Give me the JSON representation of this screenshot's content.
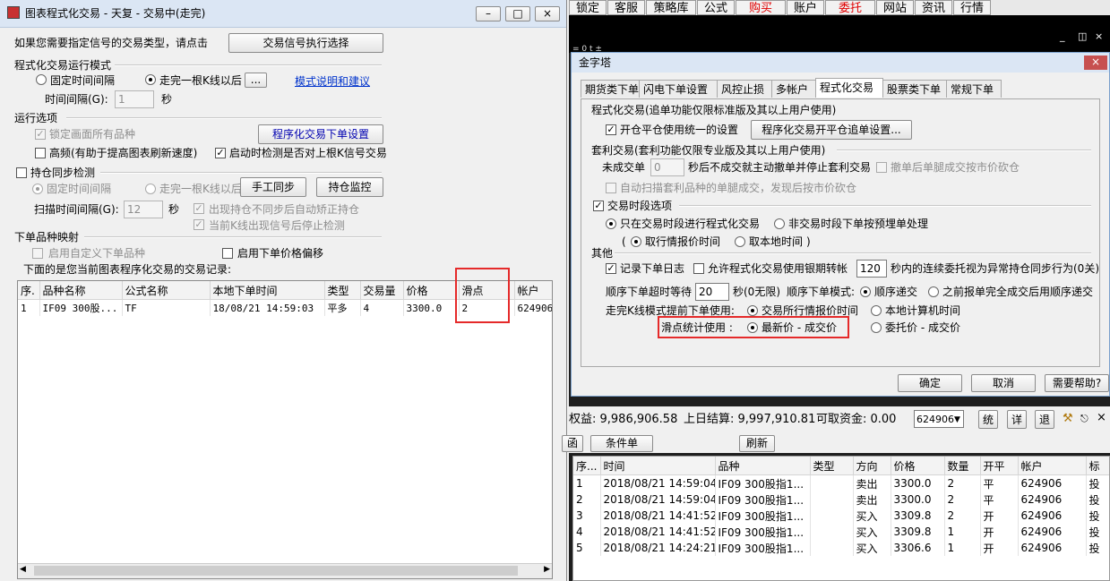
{
  "left": {
    "title": "图表程式化交易 - 天复 - 交易中(走完)",
    "prompt": "如果您需要指定信号的交易类型，请点击",
    "signal_button": "交易信号执行选择",
    "run_mode_label": "程式化交易运行模式",
    "fixed_interval": "固定时间间隔",
    "after_bar": "走完一根K线以后",
    "dots": "...",
    "mode_link": "模式说明和建议",
    "interval_label": "时间间隔(G):",
    "interval_value": "1",
    "sec": "秒",
    "run_options": "运行选项",
    "lock_all": "锁定画面所有品种",
    "order_settings_button": "程序化交易下单设置",
    "high_freq": "高频(有助于提高图表刷新速度)",
    "check_on_start": "启动时检测是否对上根K信号交易",
    "sync_detect": "持仓同步检测",
    "fixed_interval2": "固定时间间隔",
    "after_bar2": "走完一根K线以后",
    "manual_sync": "手工同步",
    "position_monitor": "持仓监控",
    "scan_label": "扫描时间间隔(G):",
    "scan_value": "12",
    "sec2": "秒",
    "auto_correct": "出现持仓不同步后自动矫正持仓",
    "stop_detect": "当前K线出现信号后停止检测",
    "mapping_label": "下单品种映射",
    "custom_symbol": "启用自定义下单品种",
    "price_offset": "启用下单价格偏移",
    "records_label": "下面的是您当前图表程序化交易的交易记录:",
    "columns": [
      "序.",
      "品种名称",
      "公式名称",
      "本地下单时间",
      "类型",
      "交易量",
      "价格",
      "滑点",
      "帐户"
    ],
    "rows": [
      [
        "1",
        "IF09 300股...",
        "TF",
        "18/08/21 14:59:03",
        "平多",
        "4",
        "3300.0",
        "2",
        "624906"
      ]
    ]
  },
  "toolbar": {
    "items": [
      "锁定",
      "客服",
      "策略库",
      "公式",
      "购买",
      "账户",
      "委托",
      "网站",
      "资讯",
      "行情"
    ],
    "red_items": [
      "购买",
      "委托"
    ],
    "strip_text": "=  0 t ±  "
  },
  "dialog": {
    "title": "金字塔",
    "tabs": [
      "期货类下单",
      "闪电下单设置",
      "风控止损",
      "多帐户",
      "程式化交易",
      "股票类下单",
      "常规下单"
    ],
    "active_tab": "程式化交易",
    "s1_title": "程式化交易(追单功能仅限标准版及其以上用户使用)",
    "unified": "开仓平仓使用统一的设置",
    "open_close_button": "程序化交易开平仓追单设置...",
    "s2_title": "套利交易(套利功能仅限专业版及其以上用户使用)",
    "unfilled_label": "未成交单",
    "unfilled_value": "0",
    "unfilled_suffix": "秒后不成交就主动撤单并停止套利交易",
    "cancel_market": "撤单后单腿成交按市价砍仓",
    "auto_scan": "自动扫描套利品种的单腿成交，发现后按市价砍仓",
    "session_label": "交易时段选项",
    "only_session": "只在交易时段进行程式化交易",
    "non_session": "非交易时段下单按预埋单处理",
    "paren_open": "(",
    "quote_time": "取行情报价时间",
    "local_time": "取本地时间",
    "paren_close": ")",
    "other": "其他",
    "log": "记录下单日志",
    "allow_bank": "允许程式化交易使用银期转帐",
    "consec_value": "120",
    "consec_suffix": "秒内的连续委托视为异常持仓同步行为(0关)",
    "seq_timeout_label": "顺序下单超时等待",
    "seq_timeout_value": "20",
    "seq_timeout_suffix": "秒(0无限)",
    "seq_mode_label": "顺序下单模式:",
    "seq_deliver": "顺序递交",
    "seq_prev": "之前报单完全成交后用顺序递交",
    "finish_label": "走完K线模式提前下单使用:",
    "exchange_time": "交易所行情报价时间",
    "local_calc": "本地计算机时间",
    "slip_label": "滑点统计使用 :",
    "latest_price": "最新价 - 成交价",
    "order_price": "委托价 - 成交价",
    "ok": "确定",
    "cancel": "取消",
    "help": "需要帮助?"
  },
  "account": {
    "equity": "权益: 9,986,906.58",
    "settle": "上日结算: 9,997,910.81",
    "available": "可取资金: 0.00",
    "account_select": "624906",
    "btn1": "统",
    "btn2": "详",
    "btn3": "退",
    "cond_left": "函",
    "cond_order": "条件单",
    "refresh": "刷新",
    "columns": [
      "序...",
      "时间",
      "品种",
      "类型",
      "方向",
      "价格",
      "数量",
      "开平",
      "帐户",
      "标"
    ],
    "rows": [
      [
        "1",
        "2018/08/21 14:59:04",
        "IF09 300股指1...",
        "",
        "卖出",
        "3300.0",
        "2",
        "平",
        "624906",
        "投"
      ],
      [
        "2",
        "2018/08/21 14:59:04",
        "IF09 300股指1...",
        "",
        "卖出",
        "3300.0",
        "2",
        "平",
        "624906",
        "投"
      ],
      [
        "3",
        "2018/08/21 14:41:52",
        "IF09 300股指1...",
        "",
        "买入",
        "3309.8",
        "2",
        "开",
        "624906",
        "投"
      ],
      [
        "4",
        "2018/08/21 14:41:52",
        "IF09 300股指1...",
        "",
        "买入",
        "3309.8",
        "1",
        "开",
        "624906",
        "投"
      ],
      [
        "5",
        "2018/08/21 14:24:21",
        "IF09 300股指1...",
        "",
        "买入",
        "3306.6",
        "1",
        "开",
        "624906",
        "投"
      ]
    ]
  },
  "colors": {
    "highlight": "#e52a2a",
    "link": "#0033cc",
    "title_blue": "#dbe6f4"
  }
}
